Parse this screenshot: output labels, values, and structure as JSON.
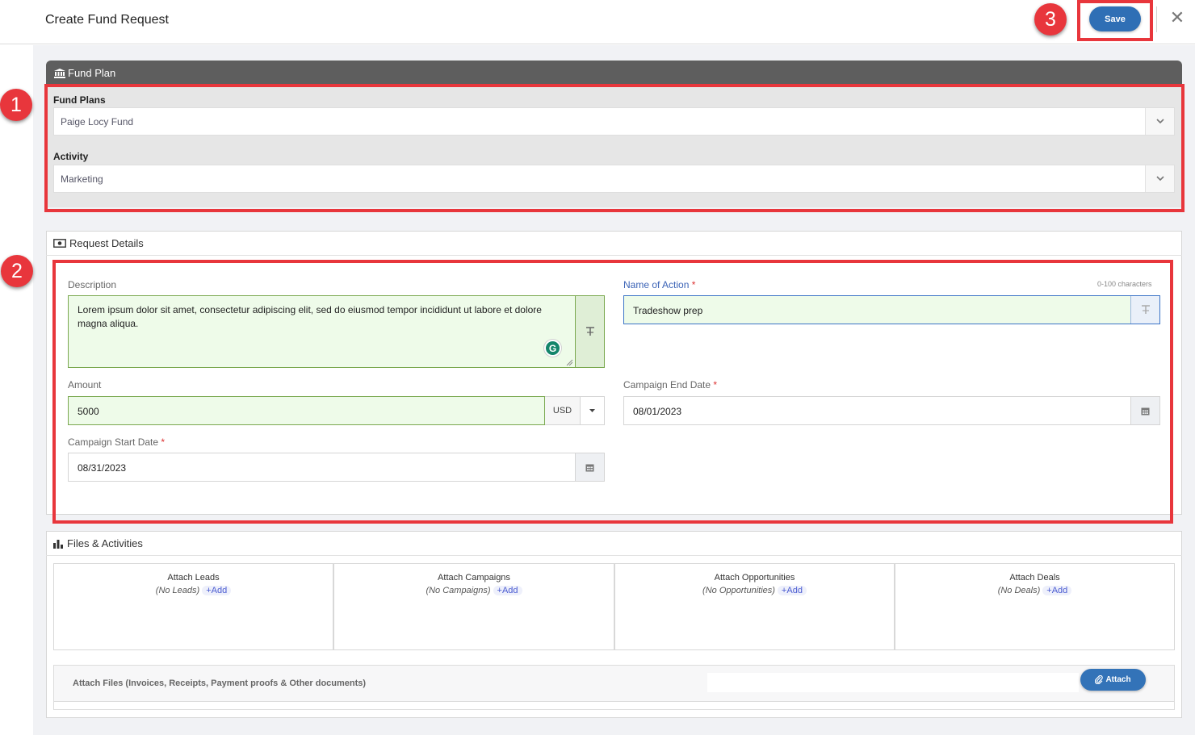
{
  "header": {
    "title": "Create Fund Request",
    "save_label": "Save"
  },
  "fund_plan": {
    "section_title": "Fund Plan",
    "fund_plans_label": "Fund Plans",
    "fund_plans_value": "Paige Locy Fund",
    "activity_label": "Activity",
    "activity_value": "Marketing"
  },
  "request_details": {
    "section_title": "Request Details",
    "description_label": "Description",
    "description_value": "Lorem ipsum dolor sit amet, consectetur adipiscing elit, sed do eiusmod tempor incididunt ut labore et dolore magna aliqua.",
    "name_label": "Name of Action",
    "name_hint": "0-100 characters",
    "name_value": "Tradeshow prep",
    "amount_label": "Amount",
    "amount_value": "5000",
    "currency": "USD",
    "end_date_label": "Campaign End Date",
    "end_date_value": "08/01/2023",
    "start_date_label": "Campaign Start Date",
    "start_date_value": "08/31/2023",
    "required_mark": "*"
  },
  "files_activities": {
    "section_title": "Files & Activities",
    "add_label": "Add",
    "boxes": [
      {
        "title": "Attach Leads",
        "empty": "(No Leads)"
      },
      {
        "title": "Attach Campaigns",
        "empty": "(No Campaigns)"
      },
      {
        "title": "Attach Opportunities",
        "empty": "(No Opportunities)"
      },
      {
        "title": "Attach Deals",
        "empty": "(No Deals)"
      }
    ],
    "files_label": "Attach Files (Invoices, Receipts, Payment proofs & Other documents)",
    "attach_label": "Attach"
  },
  "annotations": {
    "badge_1": "1",
    "badge_2": "2",
    "badge_3": "3",
    "color": "#e8363c"
  },
  "icons": [
    "bank-icon",
    "money-icon",
    "bar-chart-icon",
    "calendar-icon",
    "chevron-down-icon",
    "caret-down-icon",
    "close-icon",
    "paperclip-icon",
    "plus-icon",
    "format-icon",
    "grammarly-icon"
  ]
}
